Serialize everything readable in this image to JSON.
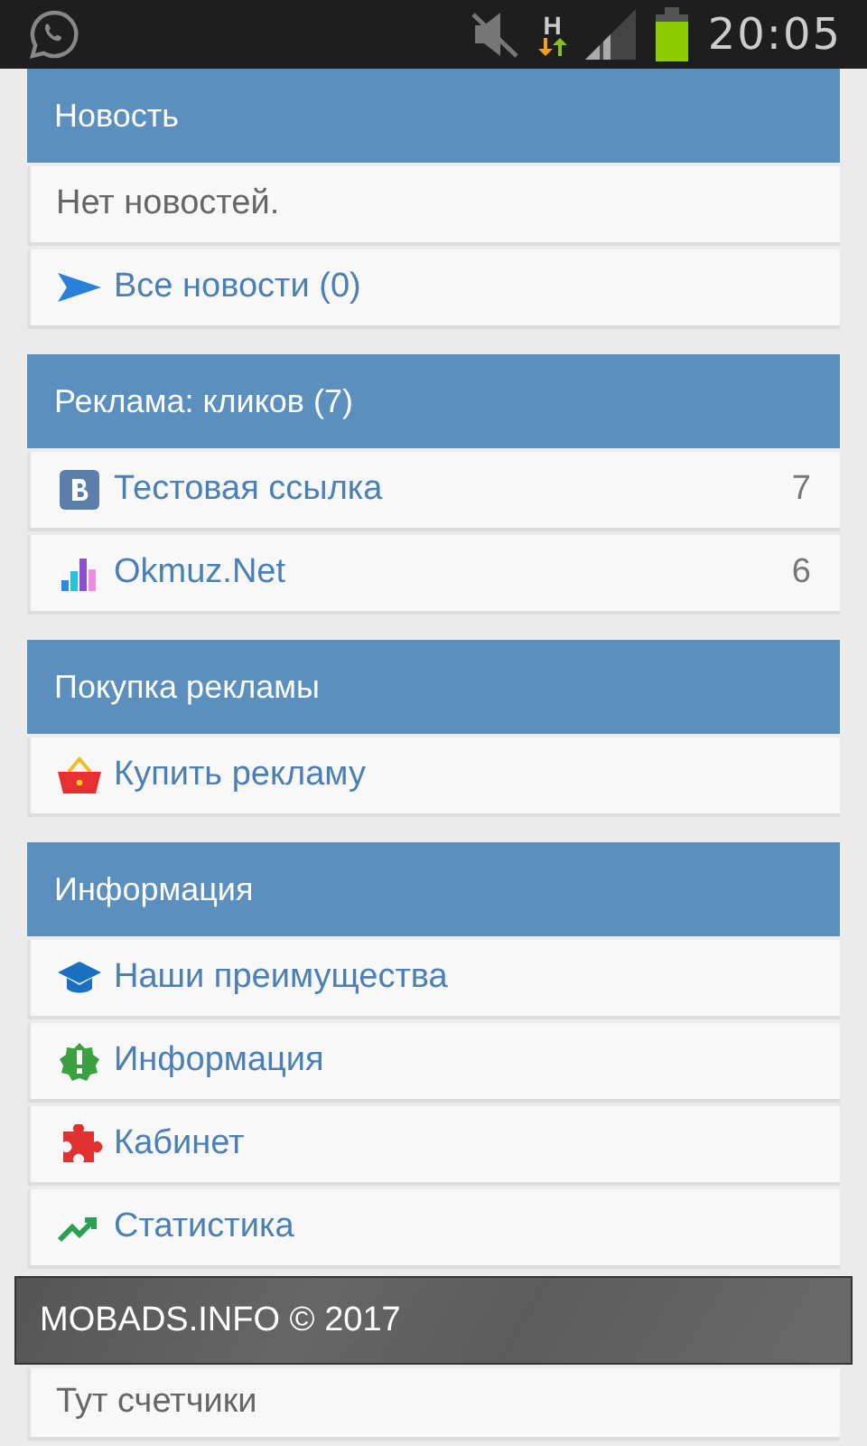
{
  "status_bar": {
    "network_type": "H",
    "time": "20:05"
  },
  "sections": [
    {
      "title": "Новость",
      "items": [
        {
          "kind": "text",
          "label": "Нет новостей."
        },
        {
          "kind": "link",
          "label": "Все новости (0)"
        }
      ]
    },
    {
      "title": "Реклама: кликов (7)",
      "items": [
        {
          "kind": "link",
          "label": "Тестовая ссылка",
          "count": "7"
        },
        {
          "kind": "link",
          "label": "Okmuz.Net",
          "count": "6"
        }
      ]
    },
    {
      "title": "Покупка рекламы",
      "items": [
        {
          "kind": "link",
          "label": "Купить рекламу"
        }
      ]
    },
    {
      "title": "Информация",
      "items": [
        {
          "kind": "link",
          "label": "Наши преимущества"
        },
        {
          "kind": "link",
          "label": "Информация"
        },
        {
          "kind": "link",
          "label": "Кабинет"
        },
        {
          "kind": "link",
          "label": "Статистика"
        }
      ]
    }
  ],
  "footer": {
    "text": "MOBADS.INFO © 2017"
  },
  "counters": {
    "text": "Тут счетчики"
  }
}
